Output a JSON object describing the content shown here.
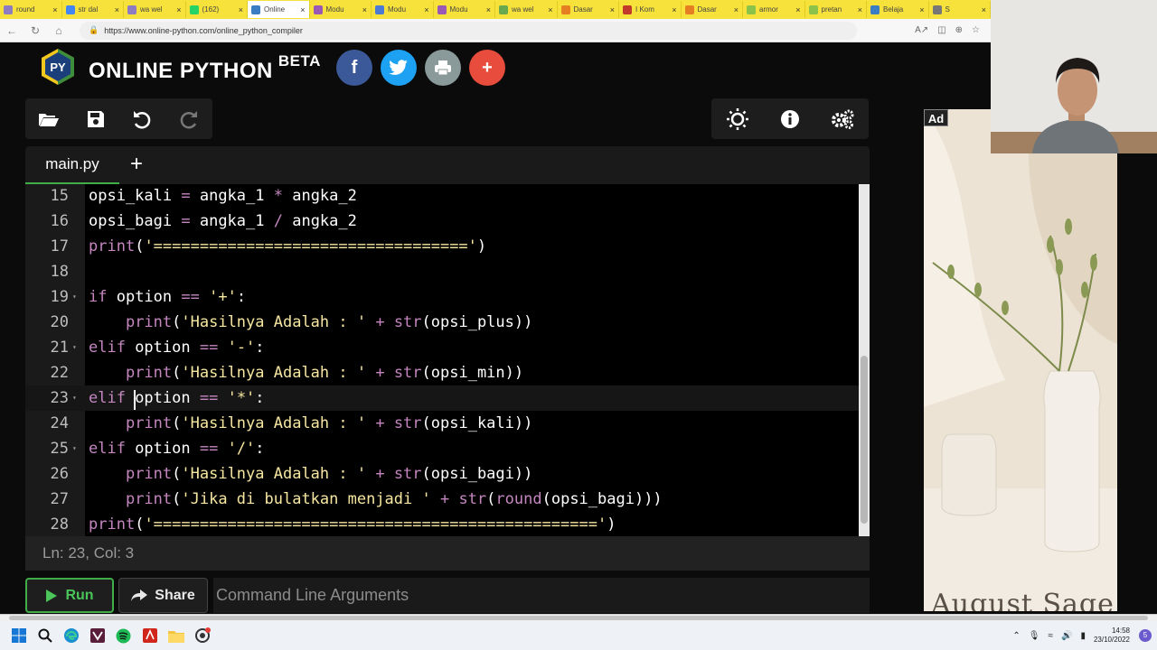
{
  "browser": {
    "tabs": [
      {
        "label": "round",
        "color": "#8e7cc3"
      },
      {
        "label": "str dal",
        "color": "#4285f4"
      },
      {
        "label": "wa wel",
        "color": "#8e7cc3"
      },
      {
        "label": "(162)",
        "color": "#25d366"
      },
      {
        "label": "Online",
        "color": "#3a7dc2",
        "active": true
      },
      {
        "label": "Modu",
        "color": "#9b59b6"
      },
      {
        "label": "Modu",
        "color": "#4a7bd4"
      },
      {
        "label": "Modu",
        "color": "#9b59b6"
      },
      {
        "label": "wa wel",
        "color": "#6aa84f"
      },
      {
        "label": "Dasar",
        "color": "#e67e22"
      },
      {
        "label": "I Kom",
        "color": "#c0392b"
      },
      {
        "label": "Dasar",
        "color": "#e67e22"
      },
      {
        "label": "armor",
        "color": "#8bc34a"
      },
      {
        "label": "pretan",
        "color": "#8bc34a"
      },
      {
        "label": "Belaja",
        "color": "#3a7dc2"
      },
      {
        "label": "S",
        "color": "#777777"
      }
    ],
    "url": "https://www.online-python.com/online_python_compiler"
  },
  "header": {
    "brand": "ONLINE PYTHON",
    "beta": "BETA",
    "logo_text": "PY",
    "social": [
      {
        "name": "facebook",
        "glyph": "f",
        "color": "#3b5998"
      },
      {
        "name": "twitter",
        "glyph": "",
        "color": "#1da1f2"
      },
      {
        "name": "print",
        "glyph": "",
        "color": "#8a9a9a"
      },
      {
        "name": "more",
        "glyph": "+",
        "color": "#e74c3c"
      }
    ]
  },
  "editor": {
    "file_tab": "main.py",
    "add_tab": "+",
    "active_line": 23,
    "lines": [
      {
        "n": "15",
        "fold": false
      },
      {
        "n": "16",
        "fold": false
      },
      {
        "n": "17",
        "fold": false
      },
      {
        "n": "18",
        "fold": false
      },
      {
        "n": "19",
        "fold": true
      },
      {
        "n": "20",
        "fold": false
      },
      {
        "n": "21",
        "fold": true
      },
      {
        "n": "22",
        "fold": false
      },
      {
        "n": "23",
        "fold": true
      },
      {
        "n": "24",
        "fold": false
      },
      {
        "n": "25",
        "fold": true
      },
      {
        "n": "26",
        "fold": false
      },
      {
        "n": "27",
        "fold": false
      },
      {
        "n": "28",
        "fold": false
      }
    ],
    "code": {
      "l15": {
        "a": "opsi_kali ",
        "b": "=",
        "c": " angka_1 ",
        "d": "*",
        "e": " angka_2"
      },
      "l16": {
        "a": "opsi_bagi ",
        "b": "=",
        "c": " angka_1 ",
        "d": "/",
        "e": " angka_2"
      },
      "l17": {
        "a": "print",
        "b": "(",
        "c": "'=================================='",
        "d": ")"
      },
      "l19": {
        "a": "if",
        "b": " option ",
        "c": "==",
        "d": " ",
        "e": "'+'",
        "f": ":"
      },
      "l20": {
        "indent": "    ",
        "a": "print",
        "b": "(",
        "c": "'Hasilnya Adalah : '",
        "d": " + ",
        "e": "str",
        "f": "(opsi_plus))"
      },
      "l21": {
        "a": "elif",
        "b": " option ",
        "c": "==",
        "d": " ",
        "e": "'-'",
        "f": ":"
      },
      "l22": {
        "indent": "    ",
        "a": "print",
        "b": "(",
        "c": "'Hasilnya Adalah : '",
        "d": " + ",
        "e": "str",
        "f": "(opsi_min))"
      },
      "l23": {
        "a": "elif",
        "b": " option ",
        "c": "==",
        "d": " ",
        "e": "'*'",
        "f": ":"
      },
      "l24": {
        "indent": "    ",
        "a": "print",
        "b": "(",
        "c": "'Hasilnya Adalah : '",
        "d": " + ",
        "e": "str",
        "f": "(opsi_kali))"
      },
      "l25": {
        "a": "elif",
        "b": " option ",
        "c": "==",
        "d": " ",
        "e": "'/'",
        "f": ":"
      },
      "l26": {
        "indent": "    ",
        "a": "print",
        "b": "(",
        "c": "'Hasilnya Adalah : '",
        "d": " + ",
        "e": "str",
        "f": "(opsi_bagi))"
      },
      "l27": {
        "indent": "    ",
        "a": "print",
        "b": "(",
        "c": "'Jika di bulatkan menjadi '",
        "d": " + ",
        "e": "str",
        "f": "(",
        "g": "round",
        "h": "(opsi_bagi)))"
      },
      "l28": {
        "a": "print",
        "b": "(",
        "c": "'================================================'",
        "d": ")"
      }
    }
  },
  "status": {
    "position": "Ln: 23,  Col: 3"
  },
  "actions": {
    "run_label": "Run",
    "share_label": "Share",
    "args_placeholder": "Command Line Arguments"
  },
  "ad": {
    "tag": "Ad",
    "title": "August Sage"
  },
  "taskbar": {
    "time": "14:58",
    "date": "23/10/2022",
    "notifications": "5"
  }
}
